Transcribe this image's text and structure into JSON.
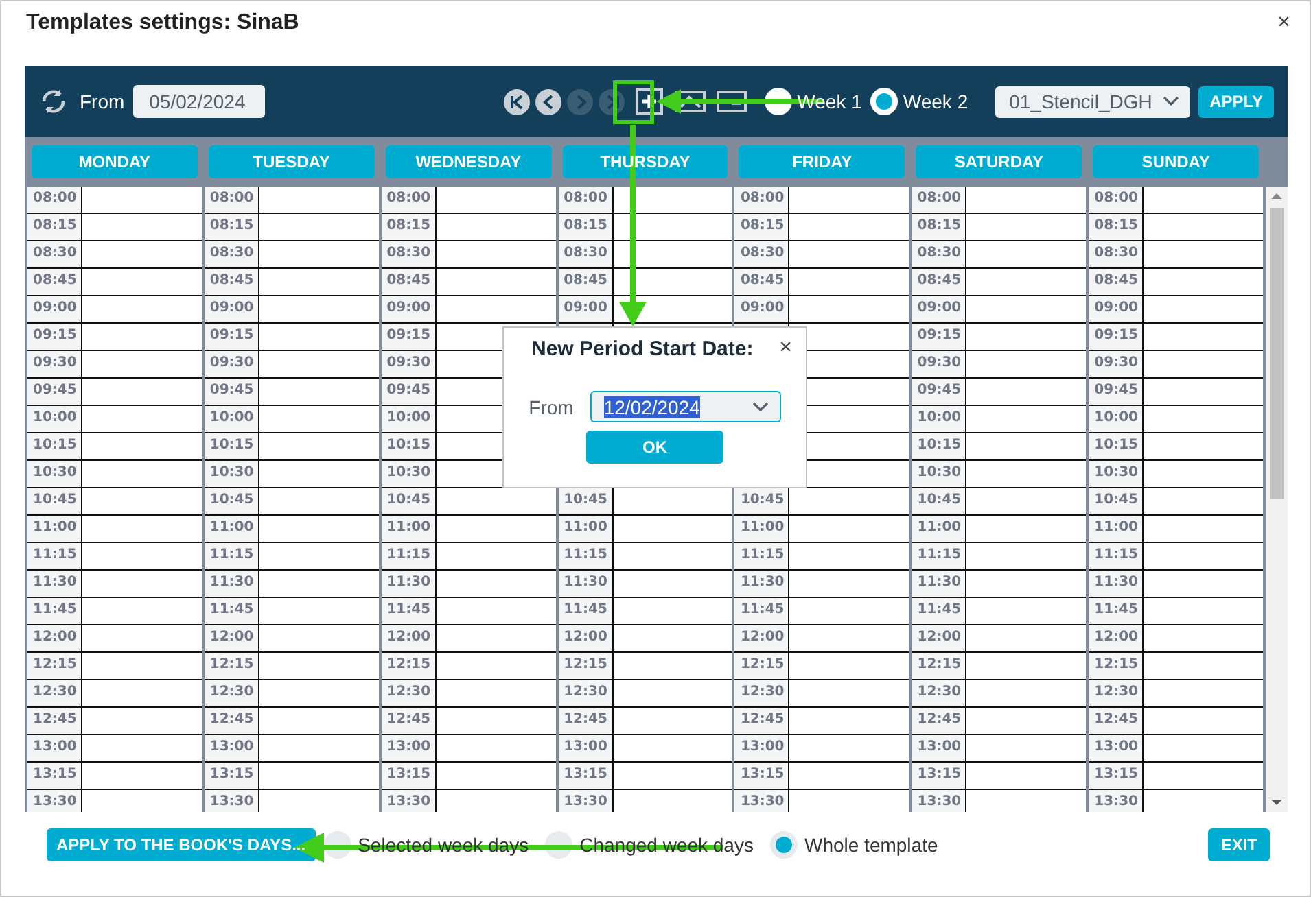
{
  "window": {
    "title": "Templates settings: SinaB",
    "close": "×"
  },
  "toolbar": {
    "from_label": "From",
    "from_date": "05/02/2024",
    "nav_buttons": [
      {
        "kind": "first",
        "disabled": false
      },
      {
        "kind": "prev",
        "disabled": false
      },
      {
        "kind": "next",
        "disabled": true
      },
      {
        "kind": "last",
        "disabled": true
      }
    ],
    "weeks": [
      {
        "label": "Week 1",
        "selected": false
      },
      {
        "label": "Week 2",
        "selected": true
      }
    ],
    "template_select": {
      "value": "01_Stencil_DGH"
    },
    "apply_button": "APPLY"
  },
  "grid": {
    "days": [
      "MONDAY",
      "TUESDAY",
      "WEDNESDAY",
      "THURSDAY",
      "FRIDAY",
      "SATURDAY",
      "SUNDAY"
    ],
    "rows": [
      {
        "cells": [
          "08:00",
          "08:00",
          "08:00",
          "08:00",
          "08:00",
          "08:00",
          "08:00"
        ]
      },
      {
        "cells": [
          "08:15",
          "08:15",
          "08:15",
          "08:15",
          "08:15",
          "08:15",
          "08:15"
        ]
      },
      {
        "cells": [
          "08:30",
          "08:30",
          "08:30",
          "08:30",
          "08:30",
          "08:30",
          "08:30"
        ]
      },
      {
        "cells": [
          "08:45",
          "08:45",
          "08:45",
          "08:45",
          "08:45",
          "08:45",
          "08:45"
        ]
      },
      {
        "cells": [
          "09:00",
          "09:00",
          "09:00",
          "09:00",
          "09:00",
          "09:00",
          "09:00"
        ]
      },
      {
        "cells": [
          "09:15",
          "09:15",
          "09:15",
          null,
          null,
          "09:15",
          "09:15"
        ]
      },
      {
        "cells": [
          "09:30",
          "09:30",
          "09:30",
          null,
          null,
          "09:30",
          "09:30"
        ]
      },
      {
        "cells": [
          "09:45",
          "09:45",
          "09:45",
          null,
          null,
          "09:45",
          "09:45"
        ]
      },
      {
        "cells": [
          "10:00",
          "10:00",
          "10:00",
          null,
          null,
          "10:00",
          "10:00"
        ]
      },
      {
        "cells": [
          "10:15",
          "10:15",
          "10:15",
          null,
          null,
          "10:15",
          "10:15"
        ]
      },
      {
        "cells": [
          "10:30",
          "10:30",
          "10:30",
          null,
          null,
          "10:30",
          "10:30"
        ]
      },
      {
        "cells": [
          "10:45",
          "10:45",
          "10:45",
          "10:45",
          "10:45",
          "10:45",
          "10:45"
        ]
      },
      {
        "cells": [
          "11:00",
          "11:00",
          "11:00",
          "11:00",
          "11:00",
          "11:00",
          "11:00"
        ]
      },
      {
        "cells": [
          "11:15",
          "11:15",
          "11:15",
          "11:15",
          "11:15",
          "11:15",
          "11:15"
        ]
      },
      {
        "cells": [
          "11:30",
          "11:30",
          "11:30",
          "11:30",
          "11:30",
          "11:30",
          "11:30"
        ]
      },
      {
        "cells": [
          "11:45",
          "11:45",
          "11:45",
          "11:45",
          "11:45",
          "11:45",
          "11:45"
        ]
      },
      {
        "cells": [
          "12:00",
          "12:00",
          "12:00",
          "12:00",
          "12:00",
          "12:00",
          "12:00"
        ]
      },
      {
        "cells": [
          "12:15",
          "12:15",
          "12:15",
          "12:15",
          "12:15",
          "12:15",
          "12:15"
        ]
      },
      {
        "cells": [
          "12:30",
          "12:30",
          "12:30",
          "12:30",
          "12:30",
          "12:30",
          "12:30"
        ]
      },
      {
        "cells": [
          "12:45",
          "12:45",
          "12:45",
          "12:45",
          "12:45",
          "12:45",
          "12:45"
        ]
      },
      {
        "cells": [
          "13:00",
          "13:00",
          "13:00",
          "13:00",
          "13:00",
          "13:00",
          "13:00"
        ]
      },
      {
        "cells": [
          "13:15",
          "13:15",
          "13:15",
          "13:15",
          "13:15",
          "13:15",
          "13:15"
        ]
      },
      {
        "cells": [
          "13:30",
          "13:30",
          "13:30",
          "13:30",
          "13:30",
          "13:30",
          "13:30"
        ]
      }
    ]
  },
  "dialog": {
    "title": "New Period Start Date:",
    "close": "×",
    "from_label": "From",
    "date": "12/02/2024",
    "ok_button": "OK"
  },
  "footer": {
    "apply_button": "APPLY TO THE BOOK'S DAYS...",
    "scope": [
      {
        "label": "Selected week days",
        "selected": false
      },
      {
        "label": "Changed week days",
        "selected": false
      },
      {
        "label": "Whole template",
        "selected": true
      }
    ],
    "exit_button": "EXIT"
  }
}
